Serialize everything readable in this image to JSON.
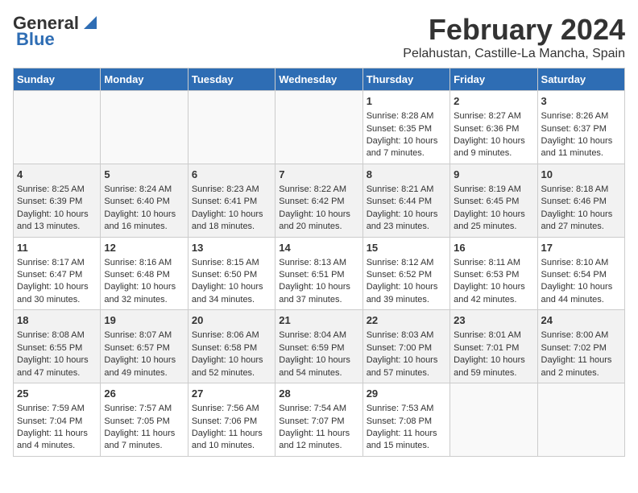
{
  "header": {
    "logo_general": "General",
    "logo_blue": "Blue",
    "month_title": "February 2024",
    "location": "Pelahustan, Castille-La Mancha, Spain"
  },
  "weekdays": [
    "Sunday",
    "Monday",
    "Tuesday",
    "Wednesday",
    "Thursday",
    "Friday",
    "Saturday"
  ],
  "weeks": [
    [
      {
        "day": "",
        "sunrise": "",
        "sunset": "",
        "daylight": "",
        "empty": true
      },
      {
        "day": "",
        "sunrise": "",
        "sunset": "",
        "daylight": "",
        "empty": true
      },
      {
        "day": "",
        "sunrise": "",
        "sunset": "",
        "daylight": "",
        "empty": true
      },
      {
        "day": "",
        "sunrise": "",
        "sunset": "",
        "daylight": "",
        "empty": true
      },
      {
        "day": "1",
        "sunrise": "Sunrise: 8:28 AM",
        "sunset": "Sunset: 6:35 PM",
        "daylight": "Daylight: 10 hours and 7 minutes.",
        "empty": false
      },
      {
        "day": "2",
        "sunrise": "Sunrise: 8:27 AM",
        "sunset": "Sunset: 6:36 PM",
        "daylight": "Daylight: 10 hours and 9 minutes.",
        "empty": false
      },
      {
        "day": "3",
        "sunrise": "Sunrise: 8:26 AM",
        "sunset": "Sunset: 6:37 PM",
        "daylight": "Daylight: 10 hours and 11 minutes.",
        "empty": false
      }
    ],
    [
      {
        "day": "4",
        "sunrise": "Sunrise: 8:25 AM",
        "sunset": "Sunset: 6:39 PM",
        "daylight": "Daylight: 10 hours and 13 minutes.",
        "empty": false
      },
      {
        "day": "5",
        "sunrise": "Sunrise: 8:24 AM",
        "sunset": "Sunset: 6:40 PM",
        "daylight": "Daylight: 10 hours and 16 minutes.",
        "empty": false
      },
      {
        "day": "6",
        "sunrise": "Sunrise: 8:23 AM",
        "sunset": "Sunset: 6:41 PM",
        "daylight": "Daylight: 10 hours and 18 minutes.",
        "empty": false
      },
      {
        "day": "7",
        "sunrise": "Sunrise: 8:22 AM",
        "sunset": "Sunset: 6:42 PM",
        "daylight": "Daylight: 10 hours and 20 minutes.",
        "empty": false
      },
      {
        "day": "8",
        "sunrise": "Sunrise: 8:21 AM",
        "sunset": "Sunset: 6:44 PM",
        "daylight": "Daylight: 10 hours and 23 minutes.",
        "empty": false
      },
      {
        "day": "9",
        "sunrise": "Sunrise: 8:19 AM",
        "sunset": "Sunset: 6:45 PM",
        "daylight": "Daylight: 10 hours and 25 minutes.",
        "empty": false
      },
      {
        "day": "10",
        "sunrise": "Sunrise: 8:18 AM",
        "sunset": "Sunset: 6:46 PM",
        "daylight": "Daylight: 10 hours and 27 minutes.",
        "empty": false
      }
    ],
    [
      {
        "day": "11",
        "sunrise": "Sunrise: 8:17 AM",
        "sunset": "Sunset: 6:47 PM",
        "daylight": "Daylight: 10 hours and 30 minutes.",
        "empty": false
      },
      {
        "day": "12",
        "sunrise": "Sunrise: 8:16 AM",
        "sunset": "Sunset: 6:48 PM",
        "daylight": "Daylight: 10 hours and 32 minutes.",
        "empty": false
      },
      {
        "day": "13",
        "sunrise": "Sunrise: 8:15 AM",
        "sunset": "Sunset: 6:50 PM",
        "daylight": "Daylight: 10 hours and 34 minutes.",
        "empty": false
      },
      {
        "day": "14",
        "sunrise": "Sunrise: 8:13 AM",
        "sunset": "Sunset: 6:51 PM",
        "daylight": "Daylight: 10 hours and 37 minutes.",
        "empty": false
      },
      {
        "day": "15",
        "sunrise": "Sunrise: 8:12 AM",
        "sunset": "Sunset: 6:52 PM",
        "daylight": "Daylight: 10 hours and 39 minutes.",
        "empty": false
      },
      {
        "day": "16",
        "sunrise": "Sunrise: 8:11 AM",
        "sunset": "Sunset: 6:53 PM",
        "daylight": "Daylight: 10 hours and 42 minutes.",
        "empty": false
      },
      {
        "day": "17",
        "sunrise": "Sunrise: 8:10 AM",
        "sunset": "Sunset: 6:54 PM",
        "daylight": "Daylight: 10 hours and 44 minutes.",
        "empty": false
      }
    ],
    [
      {
        "day": "18",
        "sunrise": "Sunrise: 8:08 AM",
        "sunset": "Sunset: 6:55 PM",
        "daylight": "Daylight: 10 hours and 47 minutes.",
        "empty": false
      },
      {
        "day": "19",
        "sunrise": "Sunrise: 8:07 AM",
        "sunset": "Sunset: 6:57 PM",
        "daylight": "Daylight: 10 hours and 49 minutes.",
        "empty": false
      },
      {
        "day": "20",
        "sunrise": "Sunrise: 8:06 AM",
        "sunset": "Sunset: 6:58 PM",
        "daylight": "Daylight: 10 hours and 52 minutes.",
        "empty": false
      },
      {
        "day": "21",
        "sunrise": "Sunrise: 8:04 AM",
        "sunset": "Sunset: 6:59 PM",
        "daylight": "Daylight: 10 hours and 54 minutes.",
        "empty": false
      },
      {
        "day": "22",
        "sunrise": "Sunrise: 8:03 AM",
        "sunset": "Sunset: 7:00 PM",
        "daylight": "Daylight: 10 hours and 57 minutes.",
        "empty": false
      },
      {
        "day": "23",
        "sunrise": "Sunrise: 8:01 AM",
        "sunset": "Sunset: 7:01 PM",
        "daylight": "Daylight: 10 hours and 59 minutes.",
        "empty": false
      },
      {
        "day": "24",
        "sunrise": "Sunrise: 8:00 AM",
        "sunset": "Sunset: 7:02 PM",
        "daylight": "Daylight: 11 hours and 2 minutes.",
        "empty": false
      }
    ],
    [
      {
        "day": "25",
        "sunrise": "Sunrise: 7:59 AM",
        "sunset": "Sunset: 7:04 PM",
        "daylight": "Daylight: 11 hours and 4 minutes.",
        "empty": false
      },
      {
        "day": "26",
        "sunrise": "Sunrise: 7:57 AM",
        "sunset": "Sunset: 7:05 PM",
        "daylight": "Daylight: 11 hours and 7 minutes.",
        "empty": false
      },
      {
        "day": "27",
        "sunrise": "Sunrise: 7:56 AM",
        "sunset": "Sunset: 7:06 PM",
        "daylight": "Daylight: 11 hours and 10 minutes.",
        "empty": false
      },
      {
        "day": "28",
        "sunrise": "Sunrise: 7:54 AM",
        "sunset": "Sunset: 7:07 PM",
        "daylight": "Daylight: 11 hours and 12 minutes.",
        "empty": false
      },
      {
        "day": "29",
        "sunrise": "Sunrise: 7:53 AM",
        "sunset": "Sunset: 7:08 PM",
        "daylight": "Daylight: 11 hours and 15 minutes.",
        "empty": false
      },
      {
        "day": "",
        "sunrise": "",
        "sunset": "",
        "daylight": "",
        "empty": true
      },
      {
        "day": "",
        "sunrise": "",
        "sunset": "",
        "daylight": "",
        "empty": true
      }
    ]
  ]
}
